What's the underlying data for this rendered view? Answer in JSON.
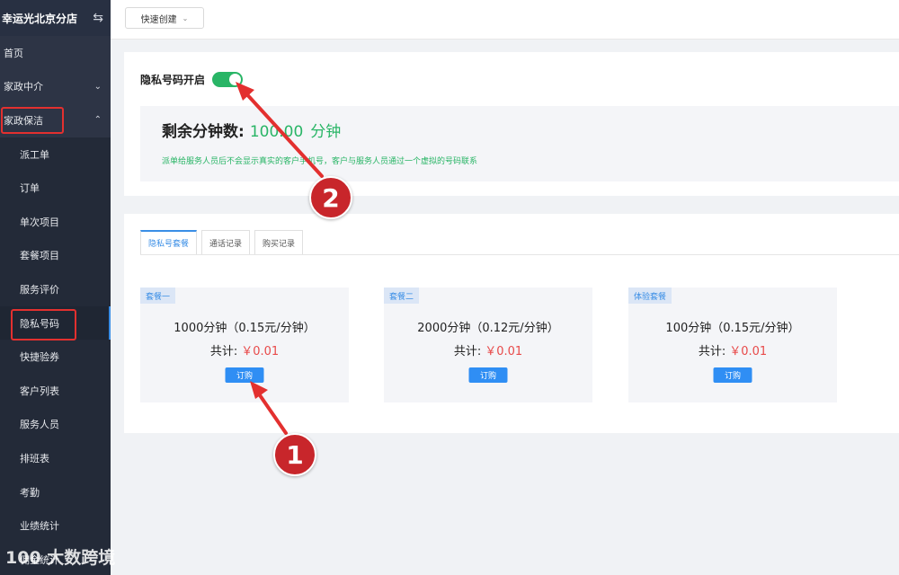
{
  "sidebar": {
    "store_title": "幸运光北京分店",
    "items": [
      {
        "label": "首页"
      },
      {
        "label": "家政中介"
      },
      {
        "label": "家政保洁"
      }
    ],
    "sub_items": [
      {
        "label": "派工单"
      },
      {
        "label": "订单"
      },
      {
        "label": "单次项目"
      },
      {
        "label": "套餐项目"
      },
      {
        "label": "服务评价"
      },
      {
        "label": "隐私号码"
      },
      {
        "label": "快捷验券"
      },
      {
        "label": "客户列表"
      },
      {
        "label": "服务人员"
      },
      {
        "label": "排班表"
      },
      {
        "label": "考勤"
      },
      {
        "label": "业绩统计"
      },
      {
        "label": "佣金统计"
      }
    ]
  },
  "topbar": {
    "quick_create_label": "快速创建"
  },
  "privacy": {
    "toggle_label": "隐私号码开启",
    "toggle_on": true,
    "minutes_label": "剩余分钟数:",
    "minutes_value": "100.00",
    "minutes_unit": "分钟",
    "description": "派单给服务人员后不会显示真实的客户手机号，客户与服务人员通过一个虚拟的号码联系"
  },
  "tabs": [
    {
      "label": "隐私号套餐",
      "active": true
    },
    {
      "label": "通话记录",
      "active": false
    },
    {
      "label": "购买记录",
      "active": false
    }
  ],
  "packages": [
    {
      "tag": "套餐一",
      "desc": "1000分钟（0.15元/分钟）",
      "total_label": "共计:",
      "price": "￥0.01",
      "button": "订购"
    },
    {
      "tag": "套餐二",
      "desc": "2000分钟（0.12元/分钟）",
      "total_label": "共计:",
      "price": "￥0.01",
      "button": "订购"
    },
    {
      "tag": "体验套餐",
      "desc": "100分钟（0.15元/分钟）",
      "total_label": "共计:",
      "price": "￥0.01",
      "button": "订购"
    }
  ],
  "annotations": {
    "badge_1": "1",
    "badge_2": "2"
  },
  "colors": {
    "accent_green": "#29b566",
    "accent_blue": "#2f8ef4",
    "price_red": "#e84a4a",
    "highlight_red": "#e3302f",
    "sidebar_bg": "#2d3445"
  },
  "watermark": "100 大数跨境"
}
